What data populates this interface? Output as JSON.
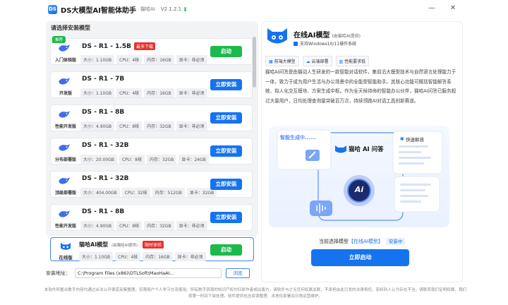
{
  "app": {
    "title": "DS大模型AI智能体助手",
    "subtitle": "猫哈AI",
    "version": "V2.1.2.1",
    "update_icon": "arrow-down-icon",
    "window_controls": [
      "minimize-icon",
      "close-icon"
    ]
  },
  "left": {
    "heading": "请选择安装模型",
    "recommend_badge": "推荐",
    "spec_labels": {
      "size": "大小：",
      "cpu": "CPU：",
      "mem": "内存：",
      "gpu": "显卡："
    },
    "models": [
      {
        "name": "DS - R1 - 1.5B",
        "badge": "最多下载",
        "label": "入门体验版",
        "size": "1.10GB",
        "cpu": "4核",
        "mem": "16GB",
        "gpu": "非必须",
        "button": "启动",
        "button_style": "green"
      },
      {
        "name": "DS - R1 - 7B",
        "badge": "",
        "label": "开发版",
        "size": "1.10GB",
        "cpu": "4核",
        "mem": "16GB",
        "gpu": "非必须",
        "button": "立即安装",
        "button_style": "blue"
      },
      {
        "name": "DS - R1 - 8B",
        "badge": "",
        "label": "性能开发版",
        "size": "4.90GB",
        "cpu": "8核",
        "mem": "32GB",
        "gpu": "非必须",
        "button": "立即安装",
        "button_style": "blue"
      },
      {
        "name": "DS - R1 - 32B",
        "badge": "",
        "label": "分布部署版",
        "size": "20.00GB",
        "cpu": "8核",
        "mem": "32GB",
        "gpu": "24GB",
        "button": "立即安装",
        "button_style": "blue"
      },
      {
        "name": "DS - R1 - 32B",
        "badge": "",
        "label": "顶级部署版",
        "size": "404.00GB",
        "cpu": "32核",
        "mem": "512GB",
        "gpu": "32GB",
        "button": "立即安装",
        "button_style": "blue"
      },
      {
        "name": "DS - R1 - 8B",
        "badge": "",
        "label": "性能开发版",
        "size": "4.90GB",
        "cpu": "8核",
        "mem": "32GB",
        "gpu": "非必须",
        "button": "立即安装",
        "button_style": "blue"
      }
    ],
    "bottom_card": {
      "name": "猫哈AI模型",
      "provider": "(由猫哈AI提供)",
      "badge": "限时体验",
      "label": "在线版",
      "size": "1.10GB",
      "cpu": "4核",
      "mem": "16GB",
      "gpu": "非必须",
      "button": "启动"
    },
    "install_path_label": "安装地址：",
    "install_path_value": "C:\\Program Files (x86)\\DTLSoft\\MaoHaAI...",
    "browse_button": "浏览"
  },
  "right": {
    "title": "在线AI模型",
    "provider": "(由猫哈AI提供)",
    "support": "支持Windows10/11操作系统",
    "tags": [
      {
        "icon": "grid-icon",
        "label": "前端大模型"
      },
      {
        "icon": "cloud-icon",
        "label": "云端部署"
      },
      {
        "icon": "chart-icon",
        "label": "性能要求低"
      }
    ],
    "description": "猫哈AI问答是由猫动人生研发的一款智能对话软件，集前沿大模型技术与自然语言处理能力于一体，致力于成为用户生活与办公场景中的全能型智能助手。其核心功能可概括智能解答系统、拟人化交互模块、方案生成中枢。作为全天候待命的智能办公伙伴，猫哈AI问答已服务超过大量用户，日均处理查询量突破百万次，持续领跑AI对话工具创新赛道。",
    "illustration": {
      "generating": "智能生成中......",
      "brand": "猫哈 AI 问答",
      "quick": "快速解惑",
      "center": "Ai"
    },
    "hint_prefix": "当前选择模型",
    "hint_model": "【在线AI模型】",
    "hint_status": "安装中",
    "start_button": "立即启动"
  },
  "disclaimer": "本软件所整合数字内容均通过合法公开渠道采集整理，仅限用户个人学习交流使用。所有数字资源的知识产权均归原作者或出版方，请软件与之无任何权属关联，不承担由此引发的法律责任。若权利人认为存在不当，请联系我们证明权属，我们将第一时间下架处理。软件提供包含资源整理、本地化部署及日常运营维护。",
  "colors": {
    "accent": "#1673ef",
    "green": "#1db94d",
    "red": "#e8322d"
  }
}
